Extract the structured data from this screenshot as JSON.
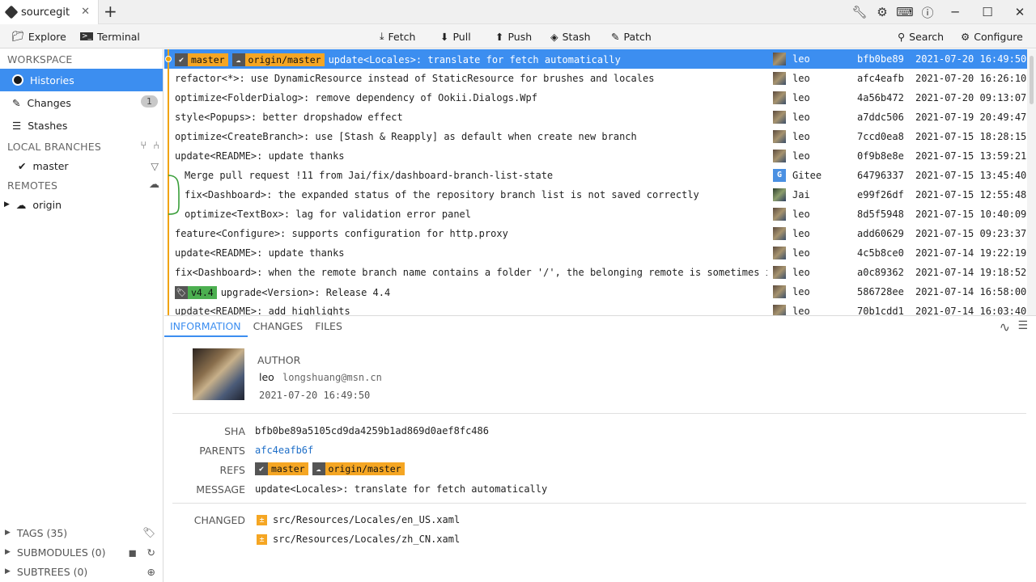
{
  "window": {
    "tab_title": "sourcegit",
    "close_glyph": "✕",
    "newtab_glyph": "+"
  },
  "toolbar": {
    "explore": "Explore",
    "terminal": "Terminal",
    "fetch": "Fetch",
    "pull": "Pull",
    "push": "Push",
    "stash": "Stash",
    "patch": "Patch",
    "search": "Search",
    "configure": "Configure"
  },
  "sidebar": {
    "workspace": "WORKSPACE",
    "histories": "Histories",
    "changes": "Changes",
    "changes_count": "1",
    "stashes": "Stashes",
    "local_branches": "LOCAL BRANCHES",
    "branch_master": "master",
    "remotes": "REMOTES",
    "remote_origin": "origin",
    "tags": "TAGS (35)",
    "submodules": "SUBMODULES (0)",
    "subtrees": "SUBTREES (0)"
  },
  "commits": [
    {
      "msg": "update<Locales>: translate for fetch automatically",
      "author": "leo",
      "sha": "bfb0be89",
      "date": "2021-07-20 16:49:50"
    },
    {
      "msg": "refactor<*>: use DynamicResource instead of StaticResource for brushes and locales",
      "author": "leo",
      "sha": "afc4eafb",
      "date": "2021-07-20 16:26:10"
    },
    {
      "msg": "optimize<FolderDialog>: remove dependency of Ookii.Dialogs.Wpf",
      "author": "leo",
      "sha": "4a56b472",
      "date": "2021-07-20 09:13:07"
    },
    {
      "msg": "style<Popups>: better dropshadow effect",
      "author": "leo",
      "sha": "a7ddc506",
      "date": "2021-07-19 20:49:47"
    },
    {
      "msg": "optimize<CreateBranch>: use [Stash & Reapply] as default when create new branch",
      "author": "leo",
      "sha": "7ccd0ea8",
      "date": "2021-07-15 18:28:15"
    },
    {
      "msg": "update<README>: update thanks",
      "author": "leo",
      "sha": "0f9b8e8e",
      "date": "2021-07-15 13:59:21"
    },
    {
      "msg": "Merge pull request !11 from Jai/fix/dashboard-branch-list-state",
      "author": "Gitee",
      "sha": "64796337",
      "date": "2021-07-15 13:45:40"
    },
    {
      "msg": "fix<Dashboard>: the expanded status of the repository branch list is not saved correctly",
      "author": "Jai",
      "sha": "e99f26df",
      "date": "2021-07-15 12:55:48"
    },
    {
      "msg": "optimize<TextBox>: lag for validation error panel",
      "author": "leo",
      "sha": "8d5f5948",
      "date": "2021-07-15 10:40:09"
    },
    {
      "msg": "feature<Configure>: supports configuration for http.proxy",
      "author": "leo",
      "sha": "add60629",
      "date": "2021-07-15 09:23:37"
    },
    {
      "msg": "update<README>: update thanks",
      "author": "leo",
      "sha": "4c5b8ce0",
      "date": "2021-07-14 19:22:19"
    },
    {
      "msg": "fix<Dashboard>: when the remote branch name contains a folder '/', the belonging remote is sometimes inco",
      "author": "leo",
      "sha": "a0c89362",
      "date": "2021-07-14 19:18:52"
    },
    {
      "msg": "upgrade<Version>: Release 4.4",
      "author": "leo",
      "sha": "586728ee",
      "date": "2021-07-14 16:58:00"
    },
    {
      "msg": "update<README>: add highlights",
      "author": "leo",
      "sha": "70b1cdd1",
      "date": "2021-07-14 16:03:40"
    }
  ],
  "refs": {
    "master": "master",
    "origin_master": "origin/master",
    "tag_v44": "v4.4"
  },
  "detail": {
    "tab_information": "INFORMATION",
    "tab_changes": "CHANGES",
    "tab_files": "FILES",
    "author_label": "AUTHOR",
    "author_name": "leo",
    "author_email": "longshuang@msn.cn",
    "author_date": "2021-07-20 16:49:50",
    "sha_label": "SHA",
    "sha": "bfb0be89a5105cd9da4259b1ad869d0aef8fc486",
    "parents_label": "PARENTS",
    "parent": "afc4eafb6f",
    "refs_label": "REFS",
    "message_label": "MESSAGE",
    "message": "update<Locales>: translate for fetch automatically",
    "changed_label": "CHANGED",
    "files": [
      "src/Resources/Locales/en_US.xaml",
      "src/Resources/Locales/zh_CN.xaml"
    ],
    "file_marker": "±"
  },
  "colors": {
    "accent": "#3c8ef0",
    "ref_branch": "#f5a623",
    "ref_tag": "#4caf50",
    "graph": "#f0a30a",
    "merge": "#3a9e3a"
  }
}
